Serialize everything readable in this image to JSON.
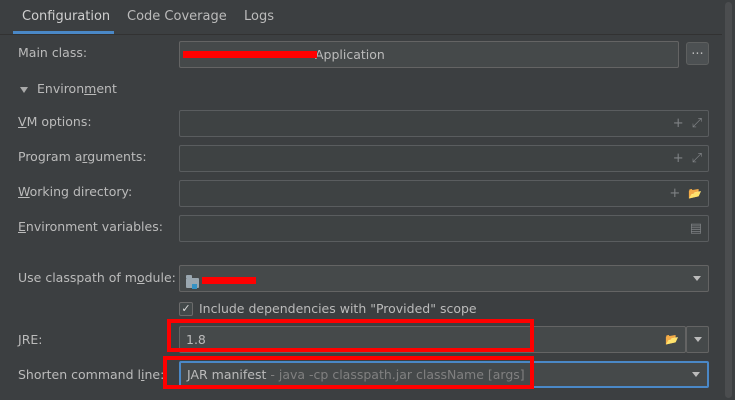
{
  "tabs": [
    {
      "label": "Configuration"
    },
    {
      "label": "Code Coverage"
    },
    {
      "label": "Logs"
    }
  ],
  "main_class": {
    "label": "Main class:",
    "value": "Application",
    "browse_label": "..."
  },
  "environment": {
    "label_pre": "Environ",
    "label_mn": "m",
    "label_post": "ent"
  },
  "vm_options": {
    "label_u": "V",
    "label_rest": "M options:"
  },
  "program_arguments": {
    "label_pre": "Program a",
    "label_u": "r",
    "label_post": "guments:"
  },
  "working_directory": {
    "label_u": "W",
    "label_rest": "orking directory:"
  },
  "environment_variables": {
    "label_u": "E",
    "label_rest": "nvironment variables:"
  },
  "classpath_module": {
    "label_pre": "Use classpath of m",
    "label_u": "o",
    "label_post": "dule:"
  },
  "include_dependencies": {
    "label": "Include dependencies with \"Provided\" scope",
    "checked": "✓"
  },
  "jre": {
    "label_u": "J",
    "label_rest": "RE:",
    "value": "1.8"
  },
  "shorten_command_line": {
    "label_pre": "Shorten command l",
    "label_u": "i",
    "label_post": "ne:",
    "value": "JAR manifest",
    "hint": " - java -cp classpath.jar className [args]"
  },
  "icons": {
    "plus": "+",
    "expand": "⤢",
    "folder": "📂",
    "document": "▤"
  },
  "colors": {
    "accent": "#4a88c7",
    "highlight": "#ff0000",
    "background": "#3c3f41"
  }
}
